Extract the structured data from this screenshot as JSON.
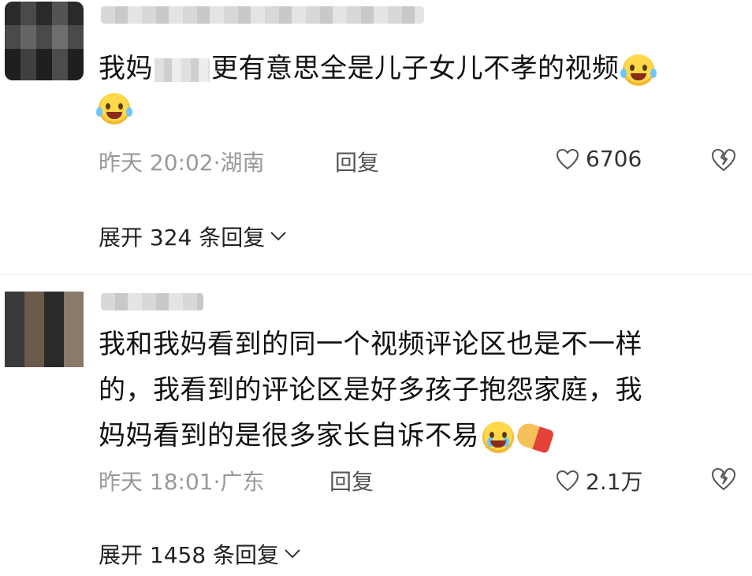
{
  "comments": [
    {
      "text_before": "我妈",
      "text_after": "更有意思全是儿子女儿不孝的视频",
      "time": "昨天 20:02",
      "location": "湖南",
      "reply_label": "回复",
      "likes": "6706",
      "expand_label": "展开 324 条回复"
    },
    {
      "line1": "我和我妈看到的同一个视频评论区也是不一样",
      "line2": "的，我看到的评论区是好多孩子抱怨家庭，我",
      "line3": "妈妈看到的是很多家长自诉不易",
      "time": "昨天 18:01",
      "location": "广东",
      "reply_label": "回复",
      "likes": "2.1万",
      "expand_label": "展开 1458 条回复"
    }
  ]
}
